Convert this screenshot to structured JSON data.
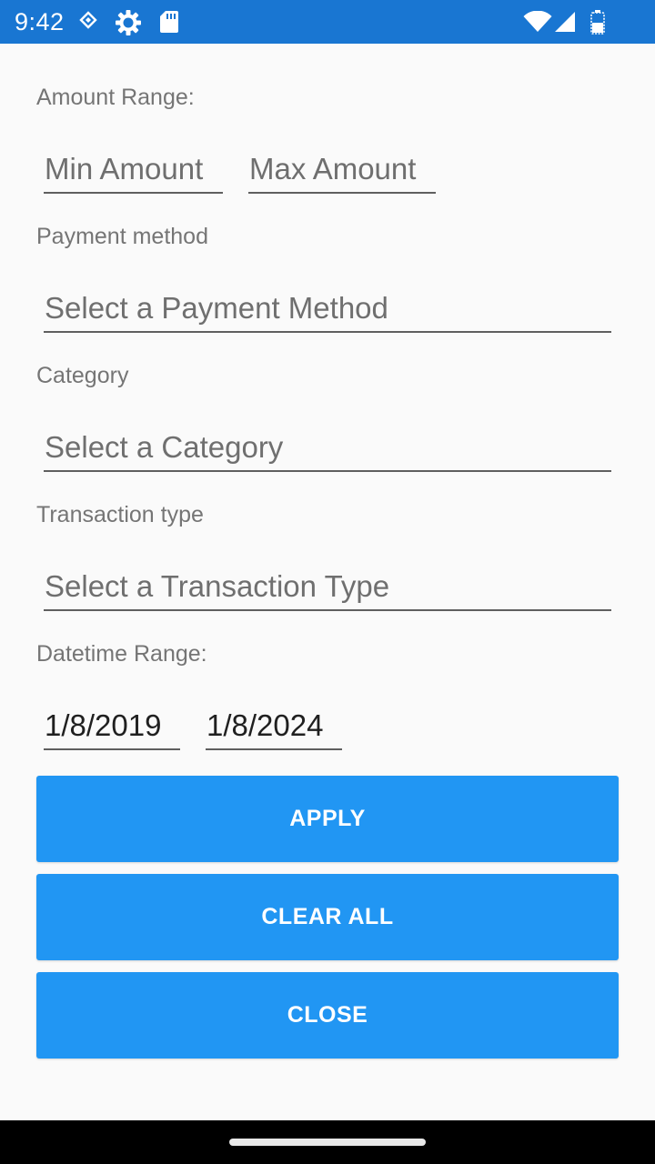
{
  "status_bar": {
    "time": "9:42",
    "icons": [
      "data-saver-icon",
      "settings-gear-icon",
      "sd-card-icon",
      "wifi-icon",
      "cell-signal-icon",
      "battery-icon"
    ],
    "background": "#1976d2"
  },
  "form": {
    "amount_range": {
      "label": "Amount Range:",
      "min_placeholder": "Min Amount",
      "max_placeholder": "Max Amount"
    },
    "payment_method": {
      "label": "Payment method",
      "placeholder": "Select a Payment Method"
    },
    "category": {
      "label": "Category",
      "placeholder": "Select a Category"
    },
    "transaction_type": {
      "label": "Transaction type",
      "placeholder": "Select a Transaction Type"
    },
    "datetime_range": {
      "label": "Datetime Range:",
      "start": "1/8/2019",
      "end": "1/8/2024"
    }
  },
  "buttons": {
    "apply": "APPLY",
    "clear_all": "CLEAR ALL",
    "close": "CLOSE",
    "color": "#2196f3"
  }
}
